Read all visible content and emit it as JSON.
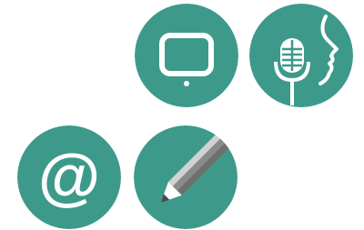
{
  "palette": {
    "circle": "#3d9a8a",
    "glyph": "#ffffff",
    "pencil_dark": "#6f6f6f",
    "pencil_light": "#d2d2d2",
    "pencil_tip": "#4a4a4a"
  },
  "icons": [
    {
      "id": "tablet",
      "icon": "tablet-icon"
    },
    {
      "id": "voice",
      "icon": "microphone-voice-icon"
    },
    {
      "id": "email",
      "icon": "at-sign-icon"
    },
    {
      "id": "write",
      "icon": "pencil-icon"
    }
  ],
  "email": {
    "symbol": "@"
  }
}
